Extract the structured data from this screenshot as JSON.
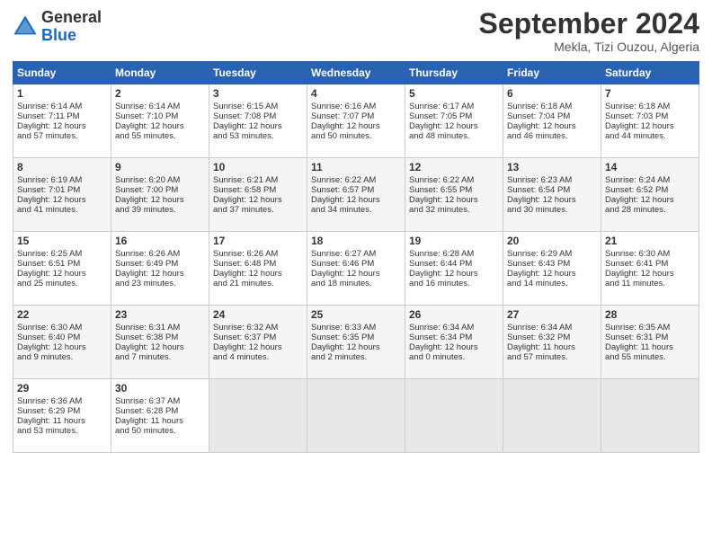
{
  "header": {
    "logo_general": "General",
    "logo_blue": "Blue",
    "month": "September 2024",
    "location": "Mekla, Tizi Ouzou, Algeria"
  },
  "weekdays": [
    "Sunday",
    "Monday",
    "Tuesday",
    "Wednesday",
    "Thursday",
    "Friday",
    "Saturday"
  ],
  "weeks": [
    [
      {
        "day": "1",
        "lines": [
          "Sunrise: 6:14 AM",
          "Sunset: 7:11 PM",
          "Daylight: 12 hours",
          "and 57 minutes."
        ]
      },
      {
        "day": "2",
        "lines": [
          "Sunrise: 6:14 AM",
          "Sunset: 7:10 PM",
          "Daylight: 12 hours",
          "and 55 minutes."
        ]
      },
      {
        "day": "3",
        "lines": [
          "Sunrise: 6:15 AM",
          "Sunset: 7:08 PM",
          "Daylight: 12 hours",
          "and 53 minutes."
        ]
      },
      {
        "day": "4",
        "lines": [
          "Sunrise: 6:16 AM",
          "Sunset: 7:07 PM",
          "Daylight: 12 hours",
          "and 50 minutes."
        ]
      },
      {
        "day": "5",
        "lines": [
          "Sunrise: 6:17 AM",
          "Sunset: 7:05 PM",
          "Daylight: 12 hours",
          "and 48 minutes."
        ]
      },
      {
        "day": "6",
        "lines": [
          "Sunrise: 6:18 AM",
          "Sunset: 7:04 PM",
          "Daylight: 12 hours",
          "and 46 minutes."
        ]
      },
      {
        "day": "7",
        "lines": [
          "Sunrise: 6:18 AM",
          "Sunset: 7:03 PM",
          "Daylight: 12 hours",
          "and 44 minutes."
        ]
      }
    ],
    [
      {
        "day": "8",
        "lines": [
          "Sunrise: 6:19 AM",
          "Sunset: 7:01 PM",
          "Daylight: 12 hours",
          "and 41 minutes."
        ]
      },
      {
        "day": "9",
        "lines": [
          "Sunrise: 6:20 AM",
          "Sunset: 7:00 PM",
          "Daylight: 12 hours",
          "and 39 minutes."
        ]
      },
      {
        "day": "10",
        "lines": [
          "Sunrise: 6:21 AM",
          "Sunset: 6:58 PM",
          "Daylight: 12 hours",
          "and 37 minutes."
        ]
      },
      {
        "day": "11",
        "lines": [
          "Sunrise: 6:22 AM",
          "Sunset: 6:57 PM",
          "Daylight: 12 hours",
          "and 34 minutes."
        ]
      },
      {
        "day": "12",
        "lines": [
          "Sunrise: 6:22 AM",
          "Sunset: 6:55 PM",
          "Daylight: 12 hours",
          "and 32 minutes."
        ]
      },
      {
        "day": "13",
        "lines": [
          "Sunrise: 6:23 AM",
          "Sunset: 6:54 PM",
          "Daylight: 12 hours",
          "and 30 minutes."
        ]
      },
      {
        "day": "14",
        "lines": [
          "Sunrise: 6:24 AM",
          "Sunset: 6:52 PM",
          "Daylight: 12 hours",
          "and 28 minutes."
        ]
      }
    ],
    [
      {
        "day": "15",
        "lines": [
          "Sunrise: 6:25 AM",
          "Sunset: 6:51 PM",
          "Daylight: 12 hours",
          "and 25 minutes."
        ]
      },
      {
        "day": "16",
        "lines": [
          "Sunrise: 6:26 AM",
          "Sunset: 6:49 PM",
          "Daylight: 12 hours",
          "and 23 minutes."
        ]
      },
      {
        "day": "17",
        "lines": [
          "Sunrise: 6:26 AM",
          "Sunset: 6:48 PM",
          "Daylight: 12 hours",
          "and 21 minutes."
        ]
      },
      {
        "day": "18",
        "lines": [
          "Sunrise: 6:27 AM",
          "Sunset: 6:46 PM",
          "Daylight: 12 hours",
          "and 18 minutes."
        ]
      },
      {
        "day": "19",
        "lines": [
          "Sunrise: 6:28 AM",
          "Sunset: 6:44 PM",
          "Daylight: 12 hours",
          "and 16 minutes."
        ]
      },
      {
        "day": "20",
        "lines": [
          "Sunrise: 6:29 AM",
          "Sunset: 6:43 PM",
          "Daylight: 12 hours",
          "and 14 minutes."
        ]
      },
      {
        "day": "21",
        "lines": [
          "Sunrise: 6:30 AM",
          "Sunset: 6:41 PM",
          "Daylight: 12 hours",
          "and 11 minutes."
        ]
      }
    ],
    [
      {
        "day": "22",
        "lines": [
          "Sunrise: 6:30 AM",
          "Sunset: 6:40 PM",
          "Daylight: 12 hours",
          "and 9 minutes."
        ]
      },
      {
        "day": "23",
        "lines": [
          "Sunrise: 6:31 AM",
          "Sunset: 6:38 PM",
          "Daylight: 12 hours",
          "and 7 minutes."
        ]
      },
      {
        "day": "24",
        "lines": [
          "Sunrise: 6:32 AM",
          "Sunset: 6:37 PM",
          "Daylight: 12 hours",
          "and 4 minutes."
        ]
      },
      {
        "day": "25",
        "lines": [
          "Sunrise: 6:33 AM",
          "Sunset: 6:35 PM",
          "Daylight: 12 hours",
          "and 2 minutes."
        ]
      },
      {
        "day": "26",
        "lines": [
          "Sunrise: 6:34 AM",
          "Sunset: 6:34 PM",
          "Daylight: 12 hours",
          "and 0 minutes."
        ]
      },
      {
        "day": "27",
        "lines": [
          "Sunrise: 6:34 AM",
          "Sunset: 6:32 PM",
          "Daylight: 11 hours",
          "and 57 minutes."
        ]
      },
      {
        "day": "28",
        "lines": [
          "Sunrise: 6:35 AM",
          "Sunset: 6:31 PM",
          "Daylight: 11 hours",
          "and 55 minutes."
        ]
      }
    ],
    [
      {
        "day": "29",
        "lines": [
          "Sunrise: 6:36 AM",
          "Sunset: 6:29 PM",
          "Daylight: 11 hours",
          "and 53 minutes."
        ]
      },
      {
        "day": "30",
        "lines": [
          "Sunrise: 6:37 AM",
          "Sunset: 6:28 PM",
          "Daylight: 11 hours",
          "and 50 minutes."
        ]
      },
      {
        "day": "",
        "lines": []
      },
      {
        "day": "",
        "lines": []
      },
      {
        "day": "",
        "lines": []
      },
      {
        "day": "",
        "lines": []
      },
      {
        "day": "",
        "lines": []
      }
    ]
  ]
}
